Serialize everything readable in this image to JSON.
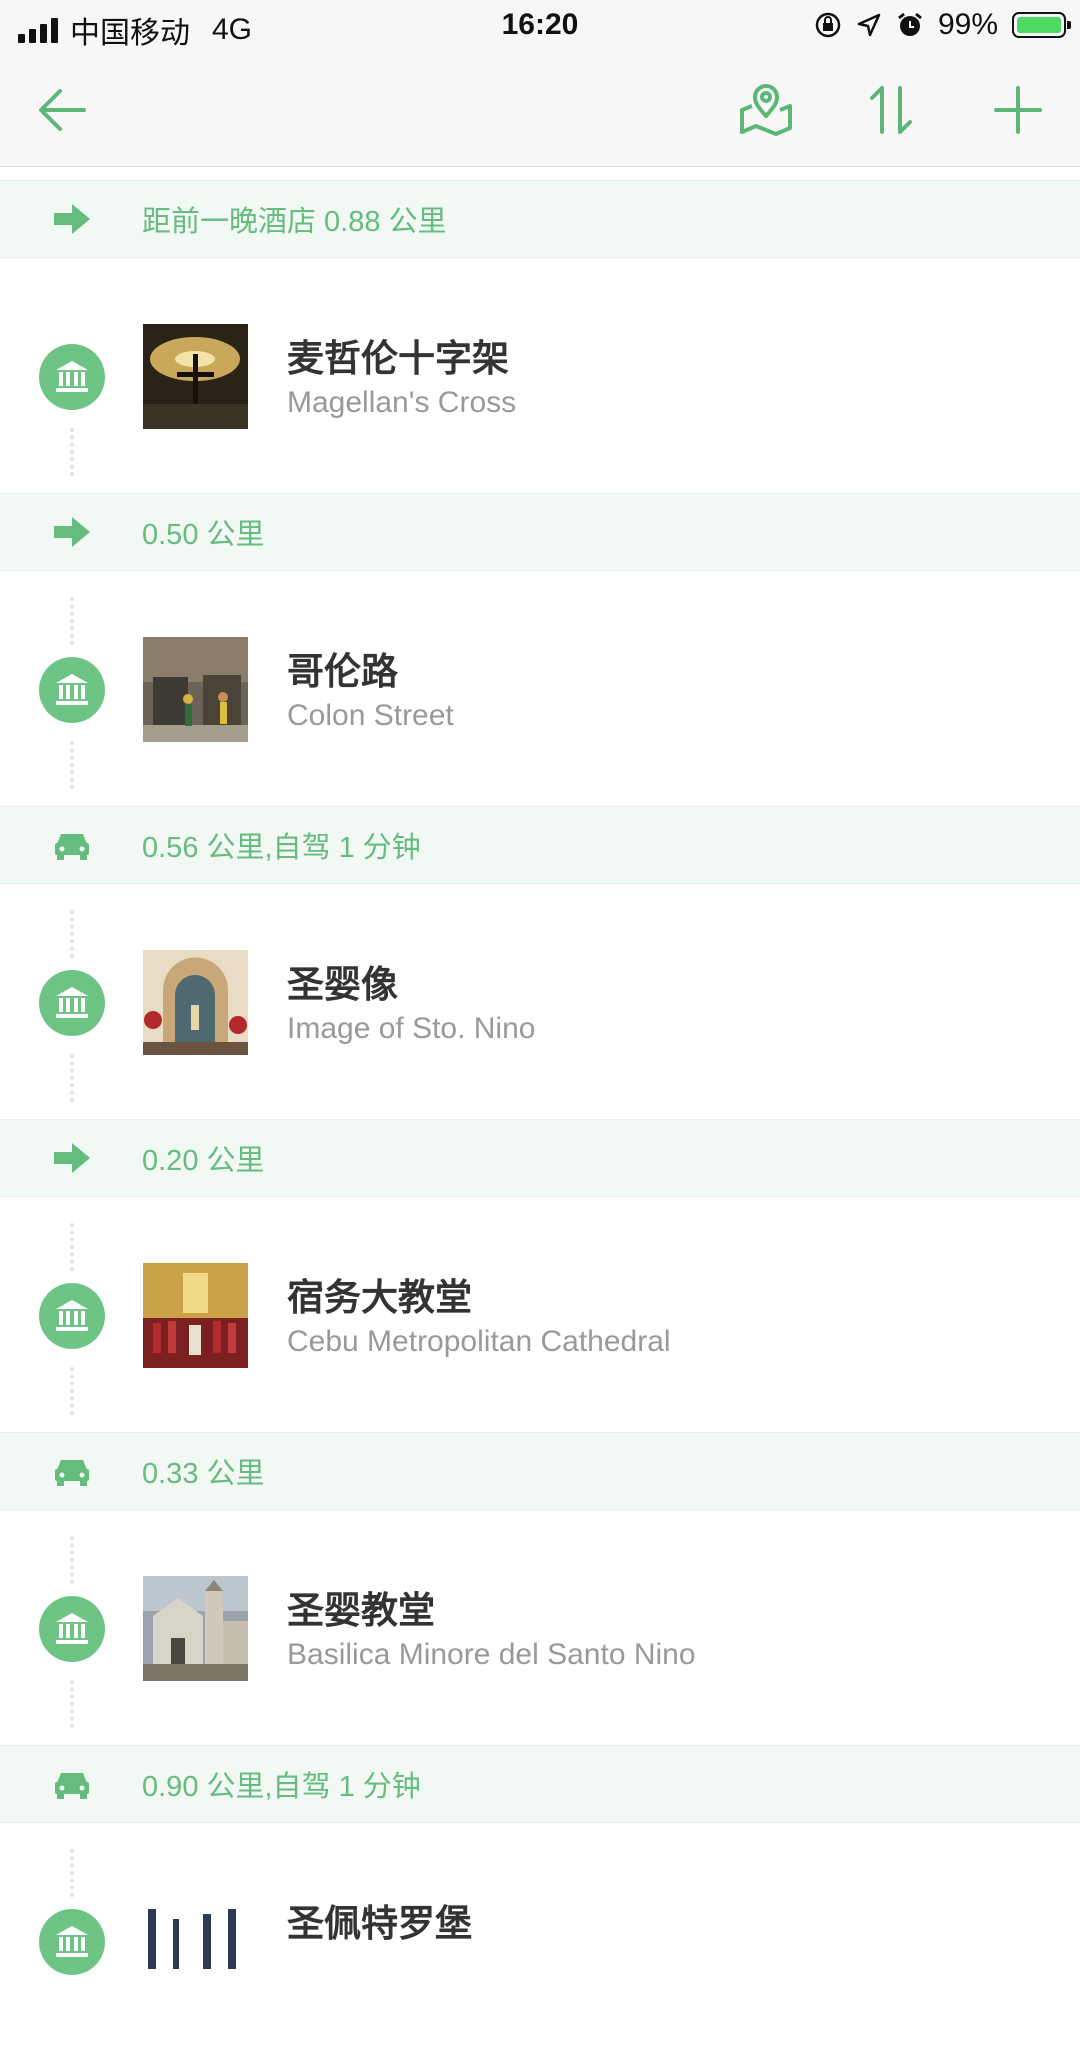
{
  "status_bar": {
    "carrier": "中国移动",
    "network": "4G",
    "time": "16:20",
    "battery_percent": "99%"
  },
  "navbar": {
    "back_icon": "back-arrow-icon",
    "map_icon": "map-pin-icon",
    "sort_icon": "sort-icon",
    "add_icon": "plus-icon"
  },
  "colors": {
    "accent": "#66bb7f",
    "poi_icon_bg": "#6ec485",
    "segment_bg": "#f2f9f4"
  },
  "items": [
    {
      "type": "segment",
      "mode": "walk",
      "text": "距前一晚酒店 0.88 公里"
    },
    {
      "type": "poi",
      "title": "麦哲伦十字架",
      "subtitle": "Magellan's Cross"
    },
    {
      "type": "segment",
      "mode": "walk",
      "text": "0.50 公里"
    },
    {
      "type": "poi",
      "title": "哥伦路",
      "subtitle": "Colon Street"
    },
    {
      "type": "segment",
      "mode": "car",
      "text": "0.56 公里,自驾 1 分钟"
    },
    {
      "type": "poi",
      "title": "圣婴像",
      "subtitle": "Image of Sto. Nino"
    },
    {
      "type": "segment",
      "mode": "walk",
      "text": "0.20 公里"
    },
    {
      "type": "poi",
      "title": "宿务大教堂",
      "subtitle": "Cebu Metropolitan Cathedral"
    },
    {
      "type": "segment",
      "mode": "car",
      "text": "0.33 公里"
    },
    {
      "type": "poi",
      "title": "圣婴教堂",
      "subtitle": "Basilica Minore del Santo Nino"
    },
    {
      "type": "segment",
      "mode": "car",
      "text": "0.90 公里,自驾 1 分钟"
    },
    {
      "type": "poi",
      "title": "圣佩特罗堡",
      "subtitle": ""
    }
  ]
}
